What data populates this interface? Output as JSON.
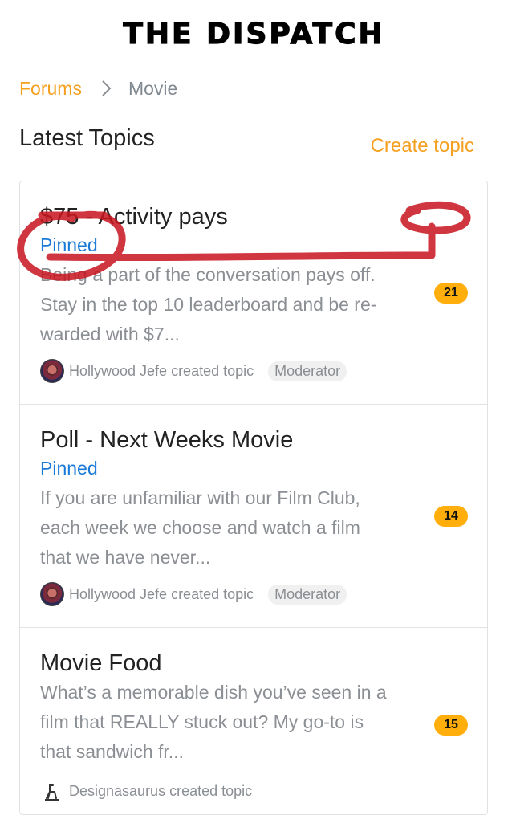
{
  "brand": {
    "title": "THE DISPATCH"
  },
  "breadcrumb": {
    "parent": "Forums",
    "current": "Movie"
  },
  "section": {
    "title": "Latest Topics",
    "create_label": "Create topic"
  },
  "topics": [
    {
      "title": "$75 - Activity pays",
      "pinned": "Pinned",
      "excerpt": [
        "Being a part of the conversation pays off.",
        "Stay in the top 10 leaderboard and be re-",
        "warded with $7..."
      ],
      "count": "21",
      "author": "Hollywood Jefe created topic",
      "role": "Moderator"
    },
    {
      "title": "Poll - Next Weeks Movie",
      "pinned": "Pinned",
      "excerpt": [
        "If you are unfamiliar with our Film Club,",
        "each week we choose and watch a film",
        "that we have never..."
      ],
      "count": "14",
      "author": "Hollywood Jefe created topic",
      "role": "Moderator"
    },
    {
      "title": "Movie Food",
      "excerpt": [
        "What’s a memorable dish you’ve seen in a",
        "film that REALLY stuck out? My go-to is",
        "that sandwich fr..."
      ],
      "count": "15",
      "author": "Designasaurus created topic"
    }
  ],
  "colors": {
    "accent": "#f5a020",
    "pinned": "#1a7ad8",
    "badge": "#ffae0c",
    "annotation": "#c8141e"
  },
  "icons": {
    "breadcrumb_separator": "chevron-right-icon",
    "avatar": "user-avatar",
    "designasaurus_avatar": "dinosaur-icon"
  }
}
